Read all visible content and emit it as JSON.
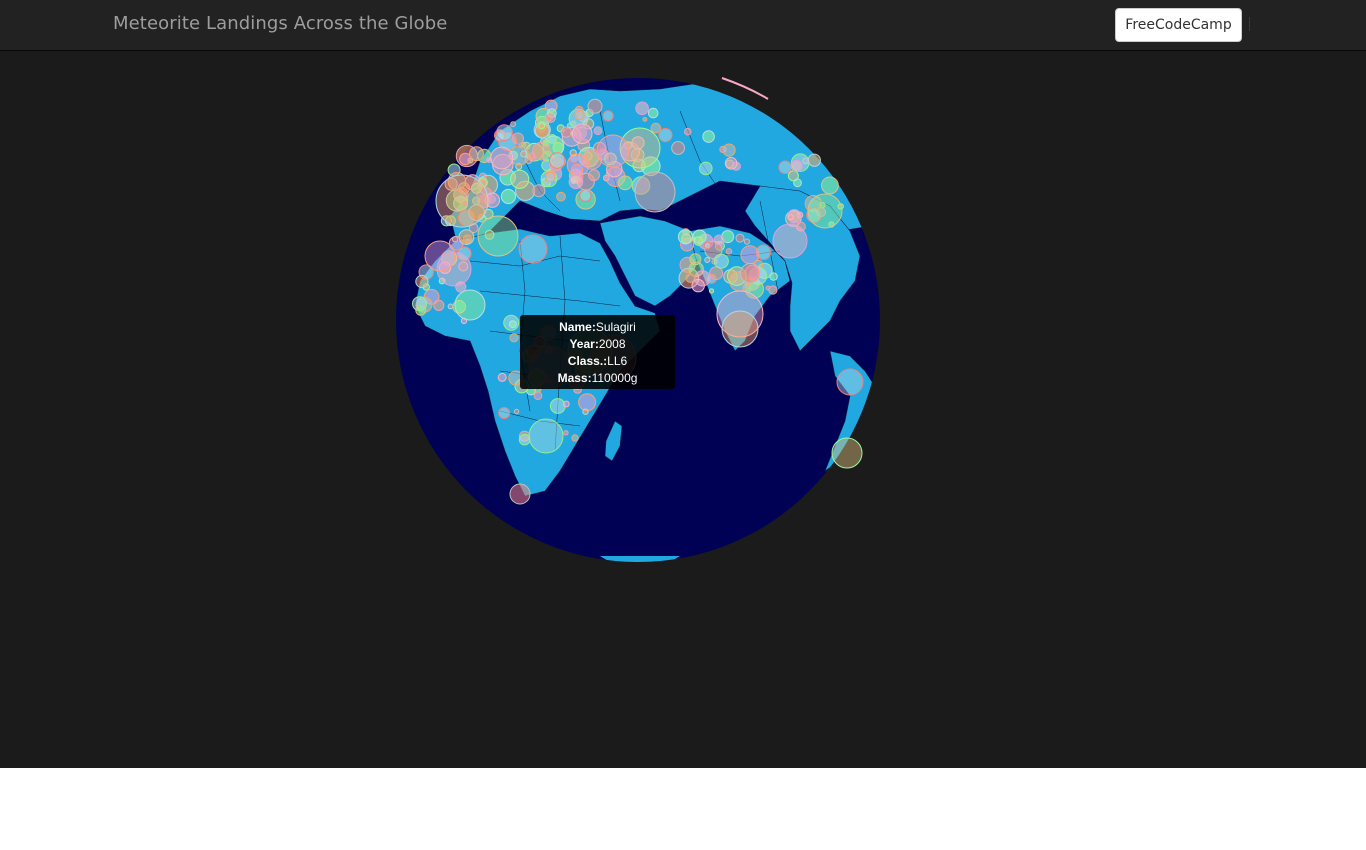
{
  "header": {
    "title": "Meteorite Landings Across the Globe",
    "button_label": "FreeCodeCamp"
  },
  "tooltip": {
    "name_label": "Name:",
    "name_value": "Sulagiri",
    "year_label": "Year:",
    "year_value": "2008",
    "class_label": "Class.:",
    "class_value": "LL6",
    "mass_label": "Mass:",
    "mass_value": "110000g"
  },
  "colors": {
    "ocean": "#000155",
    "land": "#21a8e0",
    "background": "#1b1b1b",
    "navbar": "#222222"
  }
}
